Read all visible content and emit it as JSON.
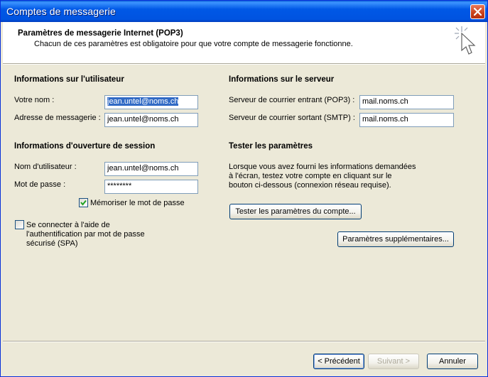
{
  "window": {
    "title": "Comptes de messagerie"
  },
  "header": {
    "title": "Paramètres de messagerie Internet (POP3)",
    "subtitle": "Chacun de ces paramètres est obligatoire pour que votre compte de messagerie fonctionne."
  },
  "user_info": {
    "heading": "Informations sur l'utilisateur",
    "name_label": "Votre nom :",
    "name_value": "jean.untel@noms.ch",
    "email_label": "Adresse de messagerie :",
    "email_value": "jean.untel@noms.ch"
  },
  "login_info": {
    "heading": "Informations d'ouverture de session",
    "username_label": "Nom d'utilisateur :",
    "username_value": "jean.untel@noms.ch",
    "password_label": "Mot de passe :",
    "password_value": "********",
    "remember_label": "Mémoriser le mot de passe",
    "remember_checked": true,
    "spa_label_1": "Se connecter à l'aide de",
    "spa_label_2": "l'authentification par mot de passe",
    "spa_label_3": "sécurisé (SPA)",
    "spa_checked": false
  },
  "server_info": {
    "heading": "Informations sur le serveur",
    "incoming_label": "Serveur de courrier entrant (POP3) :",
    "incoming_value": "mail.noms.ch",
    "outgoing_label": "Serveur de courrier sortant (SMTP) :",
    "outgoing_value": "mail.noms.ch"
  },
  "test": {
    "heading": "Tester les paramètres",
    "desc_1": "Lorsque vous avez fourni les informations demandées",
    "desc_2": "à l'écran, testez votre compte en cliquant sur le",
    "desc_3": "bouton ci-dessous (connexion réseau requise).",
    "test_button": "Tester les paramètres du compte...",
    "more_button": "Paramètres supplémentaires..."
  },
  "footer": {
    "back": "< Précédent",
    "next": "Suivant >",
    "cancel": "Annuler"
  },
  "colors": {
    "titlebar": "#0054e3",
    "selection": "#316ac5",
    "dialog": "#ece9d8"
  },
  "icons": {
    "close": "close-icon",
    "wizard": "wizard-cursor-icon",
    "check": "check-icon"
  }
}
